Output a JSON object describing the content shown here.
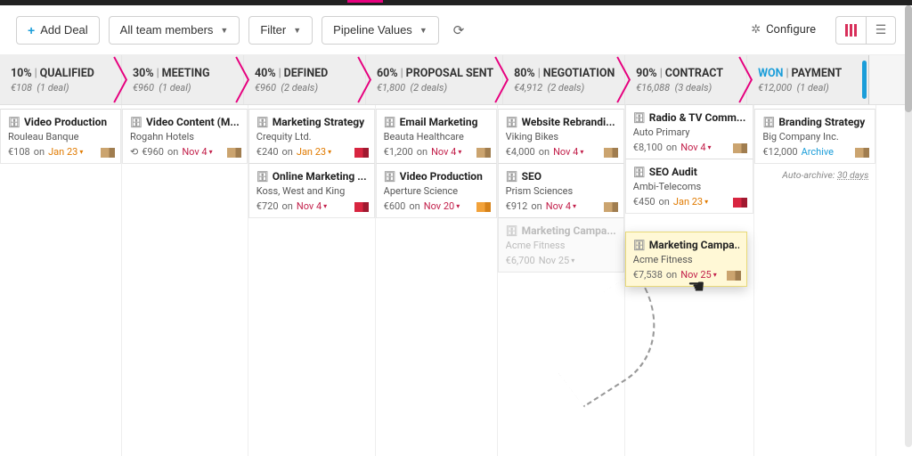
{
  "toolbar": {
    "add_deal": "Add Deal",
    "team_filter": "All team members",
    "filter": "Filter",
    "pipeline_values": "Pipeline Values",
    "configure": "Configure"
  },
  "stages": [
    {
      "pct": "10%",
      "name": "QUALIFIED",
      "total": "€108",
      "count": "(1 deal)"
    },
    {
      "pct": "30%",
      "name": "MEETING",
      "total": "€960",
      "count": "(1 deal)"
    },
    {
      "pct": "40%",
      "name": "DEFINED",
      "total": "€960",
      "count": "(2 deals)"
    },
    {
      "pct": "60%",
      "name": "PROPOSAL SENT",
      "total": "€1,800",
      "count": "(2 deals)"
    },
    {
      "pct": "80%",
      "name": "NEGOTIATION",
      "total": "€4,912",
      "count": "(2 deals)"
    },
    {
      "pct": "90%",
      "name": "CONTRACT",
      "total": "€16,088",
      "count": "(3 deals)"
    },
    {
      "pct": "WON",
      "name": "PAYMENT",
      "total": "€12,000",
      "count": "(1 deal)",
      "won": true
    }
  ],
  "cols": {
    "c0": [
      {
        "title": "Video Production",
        "company": "Rouleau Banque",
        "amount": "€108",
        "on": "on",
        "date": "Jan 23",
        "dateColor": "orange",
        "flag": "tan"
      }
    ],
    "c1": [
      {
        "title": "Video Content (M...",
        "company": "Rogahn Hotels",
        "amount": "€960",
        "on": "on",
        "date": "Nov 4",
        "dateColor": "red",
        "flag": "tan",
        "recycle": true
      }
    ],
    "c2": [
      {
        "title": "Marketing Strategy",
        "company": "Crequity Ltd.",
        "amount": "€240",
        "on": "on",
        "date": "Jan 23",
        "dateColor": "orange",
        "flag": "red"
      },
      {
        "title": "Online Marketing ...",
        "company": "Koss, West and King",
        "amount": "€720",
        "on": "on",
        "date": "Nov 4",
        "dateColor": "red",
        "flag": "red"
      }
    ],
    "c3": [
      {
        "title": "Email Marketing",
        "company": "Beauta Healthcare",
        "amount": "€1,200",
        "on": "on",
        "date": "Nov 4",
        "dateColor": "red",
        "flag": "tan"
      },
      {
        "title": "Video Production",
        "company": "Aperture Science",
        "amount": "€600",
        "on": "on",
        "date": "Nov 20",
        "dateColor": "red",
        "flag": "ora"
      }
    ],
    "c4": [
      {
        "title": "Website Rebrandi...",
        "company": "Viking Bikes",
        "amount": "€4,000",
        "on": "on",
        "date": "Nov 4",
        "dateColor": "red",
        "flag": "tan"
      },
      {
        "title": "SEO",
        "company": "Prism Sciences",
        "amount": "€912",
        "on": "on",
        "date": "Nov 4",
        "dateColor": "red",
        "flag": "tan"
      },
      {
        "title": "Marketing Campa...",
        "company": "Acme Fitness",
        "amount": "€6,700",
        "on": "",
        "date": "Nov 25",
        "dateColor": "",
        "flag": "",
        "ghost": true
      }
    ],
    "c5": [
      {
        "title": "Radio & TV Comm...",
        "company": "Auto Primary",
        "amount": "€8,100",
        "on": "on",
        "date": "Nov 4",
        "dateColor": "red",
        "flag": "tan"
      },
      {
        "title": "SEO Audit",
        "company": "Ambi-Telecoms",
        "amount": "€450",
        "on": "on",
        "date": "Jan 23",
        "dateColor": "orange",
        "flag": "red"
      }
    ],
    "c6": [
      {
        "title": "Branding Strategy",
        "company": "Big Company Inc.",
        "amount": "€12,000",
        "on": "",
        "date": "",
        "archive": "Archive",
        "flag": "tan"
      }
    ]
  },
  "drag_card": {
    "title": "Marketing Campa...",
    "company": "Acme Fitness",
    "amount": "€7,538",
    "on": "on",
    "date": "Nov 25",
    "dateColor": "red",
    "flag": "tan"
  },
  "autoarchive": {
    "label": "Auto-archive:",
    "days": "30 days"
  }
}
